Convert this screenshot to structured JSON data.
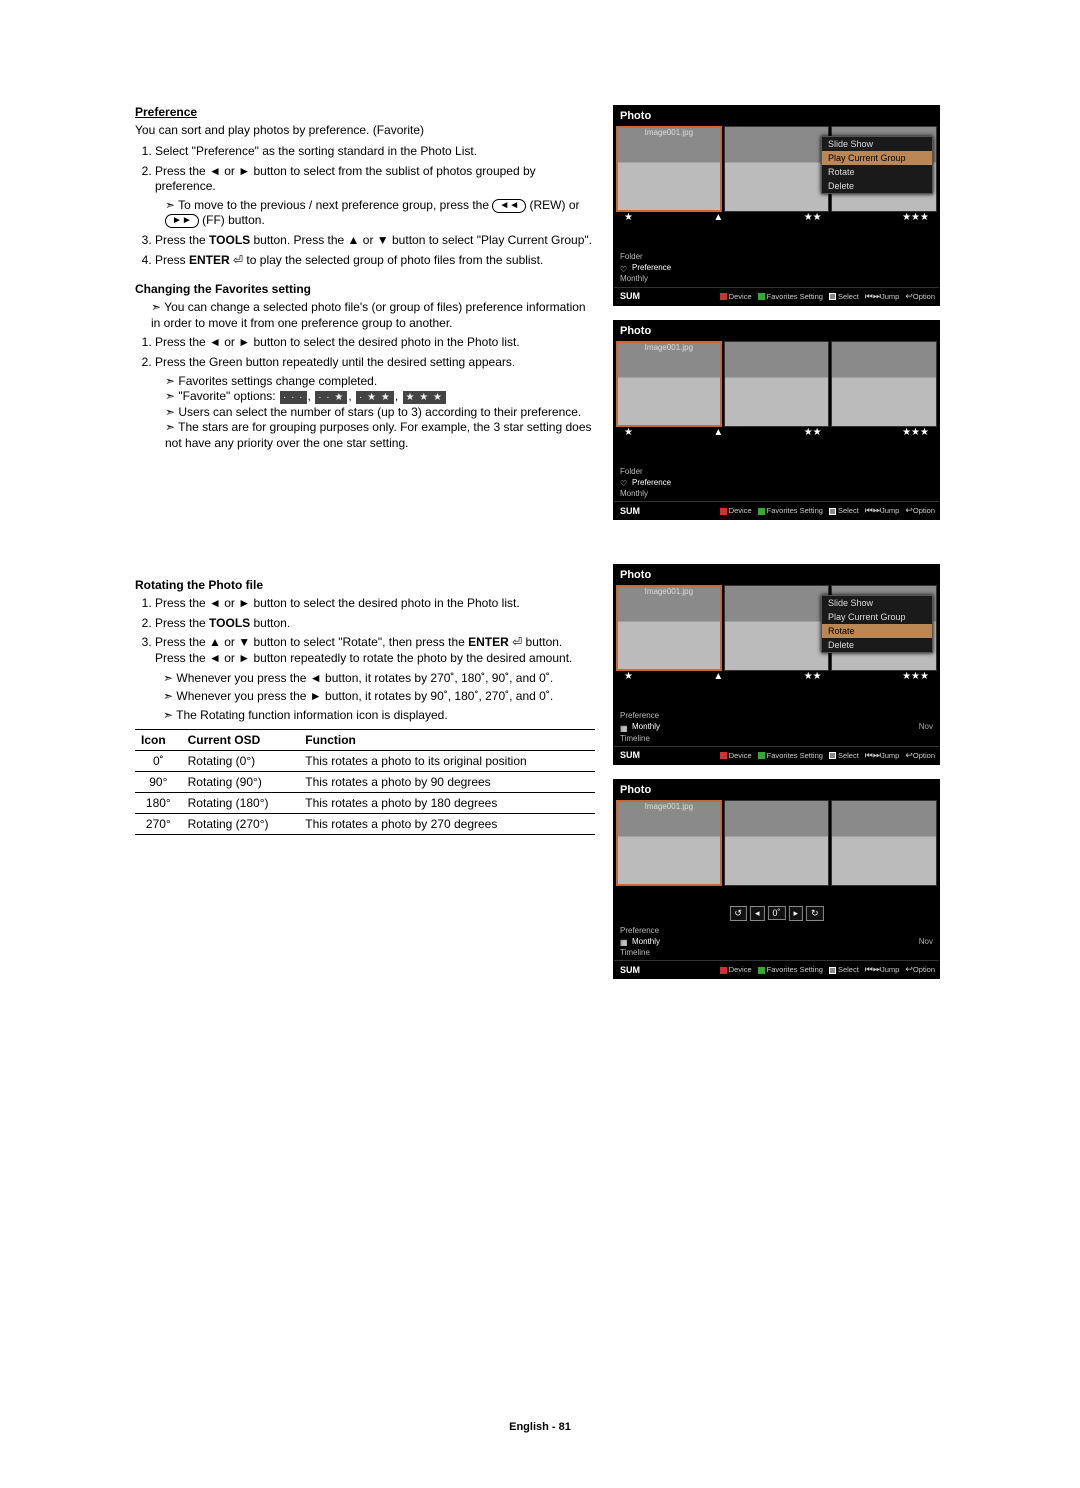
{
  "section1": {
    "title": "Preference",
    "intro": "You can sort and play photos by preference. (Favorite)",
    "steps": {
      "s1": "Select \"Preference\" as the sorting standard in the Photo List.",
      "s2a": "Press the ",
      "s2b": " or ",
      "s2c": " button to select from the sublist of photos grouped by preference.",
      "s2_sub_a": "To move to the previous / next preference group, press the ",
      "s2_sub_b": " (REW) or ",
      "s2_sub_c": " (FF) button.",
      "s3a": "Press the ",
      "s3b": " button. Press the ",
      "s3c": " or ",
      "s3d": " button to select \"Play Current Group\".",
      "s4a": "Press ",
      "s4b": " to play the selected group of photo files from the sublist."
    }
  },
  "section2": {
    "title": "Changing the Favorites setting",
    "sub1": "You can change a selected photo file's (or group of files) preference information in order to move it from one preference group to another.",
    "s1a": "Press the ",
    "s1b": " or ",
    "s1c": " button to select the desired photo in the Photo list.",
    "s2": "Press the Green button repeatedly until the desired setting appears.",
    "b1": "Favorites settings change completed.",
    "b2a": "\"Favorite\" options: ",
    "b3": "Users can select the number of stars (up to 3) according to their preference.",
    "b4": "The stars are for grouping purposes only. For example, the 3 star setting does not have any priority over the one star setting."
  },
  "section3": {
    "title": "Rotating the Photo file",
    "s1a": "Press the ",
    "s1b": " or ",
    "s1c": " button to select the desired photo in the Photo list.",
    "s2a": "Press the ",
    "s2b": " button.",
    "s3a": "Press the ",
    "s3b": " or ",
    "s3c": " button to select \"Rotate\", then press the ",
    "s3d": " button.",
    "s3e": "Press the ",
    "s3f": " or ",
    "s3g": " button repeatedly to rotate the photo by the desired amount.",
    "n1a": "Whenever you press the ",
    "n1b": " button, it rotates by 270˚, 180˚, 90˚, and 0˚.",
    "n2a": "Whenever you press the ",
    "n2b": " button, it rotates by 90˚, 180˚, 270˚, and 0˚.",
    "n3": "The Rotating function information icon is displayed."
  },
  "glyphs": {
    "left": "◄",
    "right": "►",
    "up": "▲",
    "down": "▼",
    "rew": "◄◄",
    "ff": "►►",
    "enter": "⏎"
  },
  "bold": {
    "tools": "TOOLS",
    "enter": "ENTER"
  },
  "rot_table": {
    "h1": "Icon",
    "h2": "Current OSD",
    "h3": "Function",
    "rows": [
      {
        "icon": "0˚",
        "osd": "Rotating (0°)",
        "fn": "This rotates a photo to its original position"
      },
      {
        "icon": "90°",
        "osd": "Rotating (90°)",
        "fn": "This rotates a photo by 90 degrees"
      },
      {
        "icon": "180°",
        "osd": "Rotating (180°)",
        "fn": "This rotates a photo by 180 degrees"
      },
      {
        "icon": "270°",
        "osd": "Rotating (270°)",
        "fn": "This rotates a photo by 270 degrees"
      }
    ]
  },
  "screens": {
    "title": "Photo",
    "filename": "Image001.jpg",
    "sort": {
      "folder": "Folder",
      "preference": "Preference",
      "monthly": "Monthly",
      "timeline": "Timeline"
    },
    "menu": {
      "slide": "Slide Show",
      "play": "Play Current Group",
      "rotate": "Rotate",
      "delete": "Delete"
    },
    "stars": {
      "one": "★",
      "two": "★★",
      "three": "★★★"
    },
    "foot": {
      "sum": "SUM",
      "device": "Device",
      "fav": "Favorites Setting",
      "select": "Select",
      "jump": "Jump",
      "option": "Option"
    },
    "rotbar": {
      "zero": "0˚"
    },
    "nov": "Nov"
  },
  "page_footer": "English - 81"
}
